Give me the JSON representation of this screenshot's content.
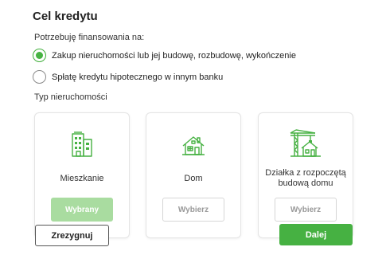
{
  "title": "Cel kredytu",
  "financing": {
    "label": "Potrzebuję finansowania na:",
    "options": [
      {
        "label": "Zakup nieruchomości lub jej budowę, rozbudowę, wykończenie",
        "checked": true
      },
      {
        "label": "Spłatę kredytu hipotecznego w innym banku",
        "checked": false
      }
    ]
  },
  "property_type": {
    "label": "Typ nieruchomości",
    "cards": [
      {
        "name": "Mieszkanie",
        "icon": "apartment-building-icon",
        "button": "Wybrany",
        "selected": true
      },
      {
        "name": "Dom",
        "icon": "house-icon",
        "button": "Wybierz",
        "selected": false
      },
      {
        "name": "Działka z rozpoczętą budową domu",
        "icon": "crane-construction-icon",
        "button": "Wybierz",
        "selected": false
      }
    ]
  },
  "footer": {
    "cancel": "Zrezygnuj",
    "next": "Dalej"
  },
  "colors": {
    "accent": "#46b142",
    "selected_button": "#a9dca0"
  }
}
